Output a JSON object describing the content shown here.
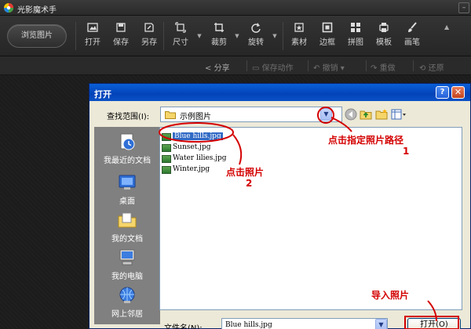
{
  "app": {
    "title": "光影魔术手"
  },
  "toolbar": {
    "browse_label": "浏览图片",
    "items": [
      {
        "label": "打开",
        "icon": "open-image-icon"
      },
      {
        "label": "保存",
        "icon": "save-icon"
      },
      {
        "label": "另存",
        "icon": "save-as-icon"
      },
      {
        "label": "尺寸",
        "icon": "resize-icon"
      },
      {
        "label": "裁剪",
        "icon": "crop-icon"
      },
      {
        "label": "旋转",
        "icon": "rotate-icon"
      },
      {
        "label": "素材",
        "icon": "material-icon"
      },
      {
        "label": "边框",
        "icon": "border-icon"
      },
      {
        "label": "拼图",
        "icon": "collage-icon"
      },
      {
        "label": "模板",
        "icon": "template-icon"
      },
      {
        "label": "画笔",
        "icon": "brush-icon"
      }
    ]
  },
  "subbar": {
    "share": "分享",
    "save_action": "保存动作",
    "undo": "撤销",
    "redo": "重做",
    "restore": "还原"
  },
  "dialog": {
    "title": "打开",
    "help": "?",
    "close": "✕",
    "lookin_label": "查找范围(I):",
    "lookin_value": "示例图片",
    "places": [
      {
        "label": "我最近的文档",
        "icon": "recent-documents-icon"
      },
      {
        "label": "桌面",
        "icon": "desktop-icon"
      },
      {
        "label": "我的文档",
        "icon": "my-documents-icon"
      },
      {
        "label": "我的电脑",
        "icon": "my-computer-icon"
      },
      {
        "label": "网上邻居",
        "icon": "network-places-icon"
      }
    ],
    "files": [
      {
        "name": "Blue hills.jpg",
        "selected": true
      },
      {
        "name": "Sunset.jpg",
        "selected": false
      },
      {
        "name": "Water lilies.jpg",
        "selected": false
      },
      {
        "name": "Winter.jpg",
        "selected": false
      }
    ],
    "filename_label": "文件名(N):",
    "filename_value": "Blue hills.jpg",
    "open_button": "打开(O)"
  },
  "annotations": {
    "step1_text": "点击指定照片路径",
    "step1_num": "1",
    "step2_text": "点击照片",
    "step2_num": "2",
    "step3_text": "导入照片",
    "color": "#d40000"
  }
}
